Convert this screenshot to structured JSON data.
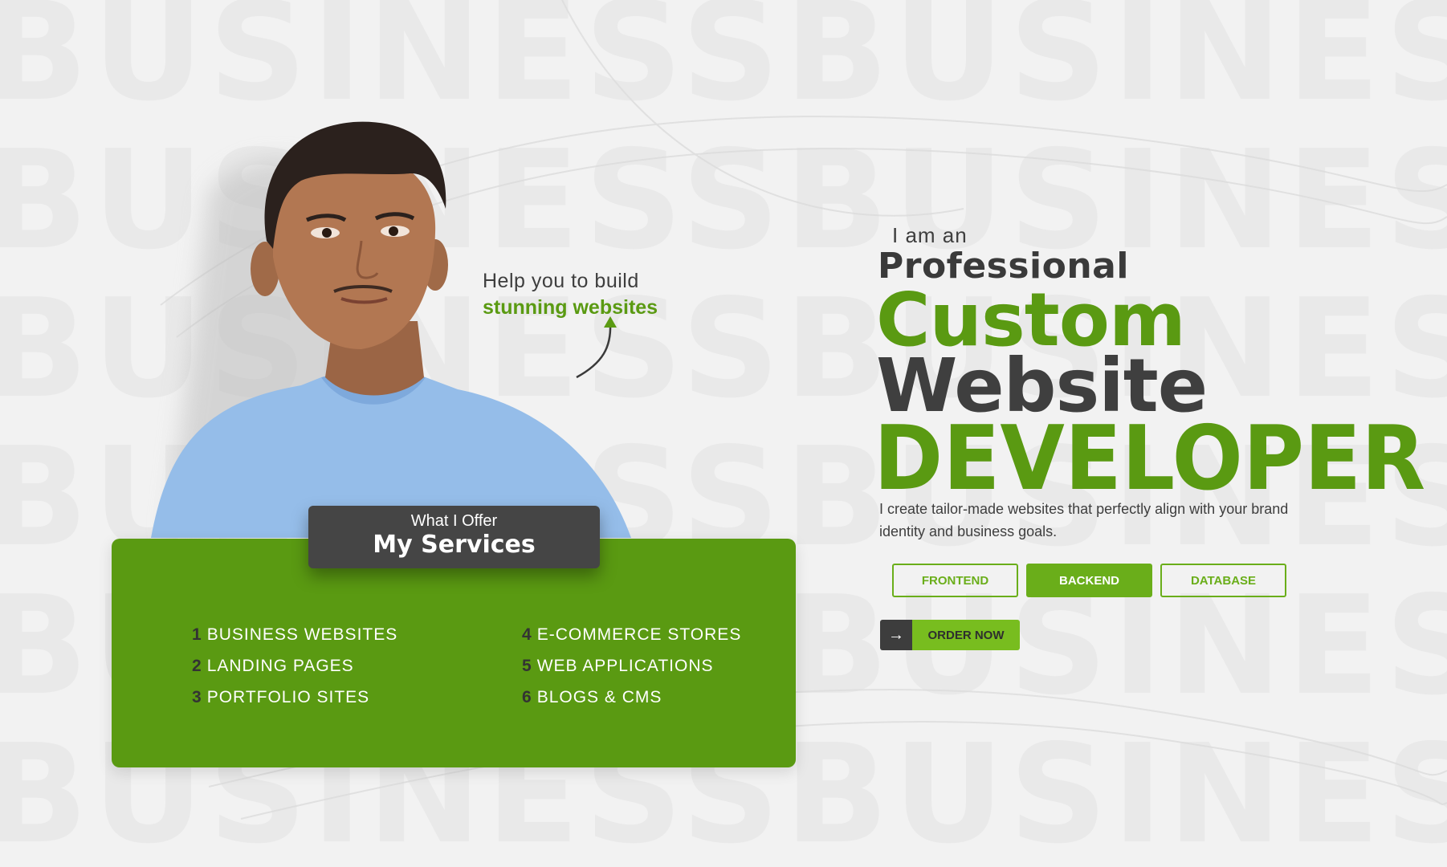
{
  "background": {
    "watermark_text": "BUSINESSBUSINESS"
  },
  "tagline": {
    "line1": "Help you to build",
    "line2": "stunning websites"
  },
  "services": {
    "tab_subtitle": "What I Offer",
    "tab_title": "My Services",
    "left": [
      {
        "num": "1",
        "label": "BUSINESS WEBSITES"
      },
      {
        "num": "2",
        "label": "LANDING PAGES"
      },
      {
        "num": "3",
        "label": "PORTFOLIO SITES"
      }
    ],
    "right": [
      {
        "num": "4",
        "label": "E-COMMERCE STORES"
      },
      {
        "num": "5",
        "label": "WEB APPLICATIONS"
      },
      {
        "num": "6",
        "label": "BLOGS & CMS"
      }
    ]
  },
  "hero": {
    "intro": "I am an",
    "line1": "Professional",
    "line2": "Custom",
    "line3": "Website",
    "line4": "DEVELOPER",
    "description": "I create tailor-made websites that perfectly align with your brand identity and business goals."
  },
  "tags": {
    "frontend": "FRONTEND",
    "backend": "BACKEND",
    "database": "DATABASE",
    "active": "BACKEND"
  },
  "cta": {
    "icon": "arrow-right-icon",
    "label": "ORDER NOW"
  },
  "colors": {
    "accent": "#5a9a12",
    "accent_light": "#78bd1f",
    "dark": "#3d3d3d",
    "background": "#f2f2f2"
  }
}
